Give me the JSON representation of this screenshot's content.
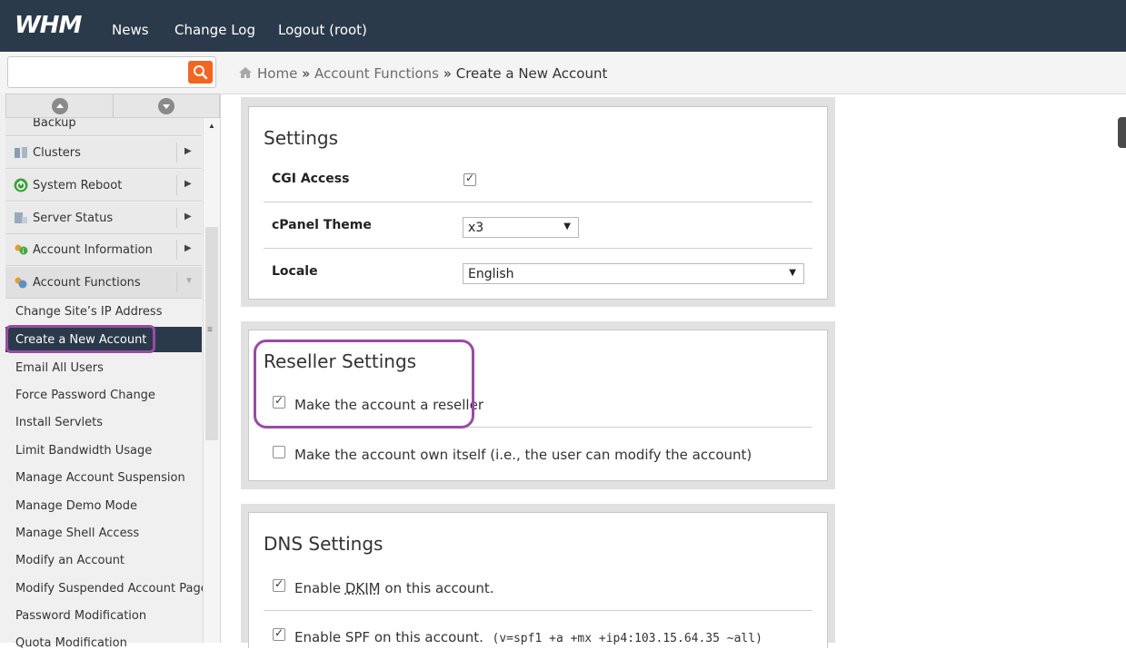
{
  "topbar": {
    "logo": "WHM",
    "links": [
      "News",
      "Change Log",
      "Logout (root)"
    ]
  },
  "search": {
    "placeholder": "",
    "value": ""
  },
  "breadcrumb": {
    "home": "Home",
    "sep": "»",
    "section": "Account Functions",
    "page": "Create a New Account"
  },
  "sidebar": {
    "partial_top": "Backup",
    "items": [
      {
        "label": "Clusters",
        "icon": "server-cluster-icon"
      },
      {
        "label": "System Reboot",
        "icon": "power-icon"
      },
      {
        "label": "Server Status",
        "icon": "server-status-icon"
      },
      {
        "label": "Account Information",
        "icon": "account-info-icon"
      },
      {
        "label": "Account Functions",
        "icon": "account-functions-icon"
      }
    ],
    "subitems": [
      "Change Site’s IP Address",
      "Create a New Account",
      "Email All Users",
      "Force Password Change",
      "Install Servlets",
      "Limit Bandwidth Usage",
      "Manage Account Suspension",
      "Manage Demo Mode",
      "Manage Shell Access",
      "Modify an Account",
      "Modify Suspended Account Page",
      "Password Modification",
      "Quota Modification"
    ],
    "active_subitem": "Create a New Account"
  },
  "settings": {
    "title": "Settings",
    "cgi_label": "CGI Access",
    "cgi_checked": true,
    "theme_label": "cPanel Theme",
    "theme_value": "x3",
    "locale_label": "Locale",
    "locale_value": "English"
  },
  "reseller": {
    "title": "Reseller Settings",
    "make_reseller": "Make the account a reseller",
    "make_reseller_checked": true,
    "own_itself": "Make the account own itself (i.e., the user can modify the account)",
    "own_itself_checked": false
  },
  "dns": {
    "title": "DNS Settings",
    "dkim_prefix": "Enable ",
    "dkim_abbr": "DKIM",
    "dkim_suffix": " on this account.",
    "dkim_checked": true,
    "spf_text": "Enable SPF on this account.",
    "spf_record": "(v=spf1 +a +mx +ip4:103.15.64.35 ~all)",
    "spf_checked": true
  },
  "colors": {
    "topbar": "#2b3a4a",
    "search_button": "#f26522",
    "highlight": "#9b4aa8"
  }
}
